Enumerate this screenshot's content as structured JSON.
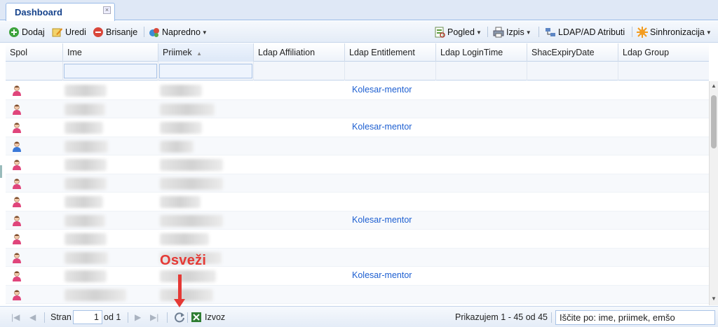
{
  "tab": {
    "title": "Dashboard",
    "close": "×"
  },
  "toolbar": {
    "add": "Dodaj",
    "edit": "Uredi",
    "delete": "Brisanje",
    "advanced": "Napredno",
    "view": "Pogled",
    "print": "Izpis",
    "ldap_attrs": "LDAP/AD Atributi",
    "sync": "Sinhronizacija"
  },
  "columns": {
    "gender": "Spol",
    "first_name": "Ime",
    "last_name": "Priimek",
    "sort_indicator": "▲",
    "affiliation": "Ldap Affiliation",
    "entitlement": "Ldap Entitlement",
    "login_time": "Ldap LoginTime",
    "expiry": "ShacExpiryDate",
    "group": "Ldap Group"
  },
  "rows": [
    {
      "gender": "female",
      "entitlement": "Kolesar-mentor"
    },
    {
      "gender": "female",
      "entitlement": ""
    },
    {
      "gender": "female",
      "entitlement": "Kolesar-mentor"
    },
    {
      "gender": "male",
      "entitlement": ""
    },
    {
      "gender": "female",
      "entitlement": ""
    },
    {
      "gender": "female",
      "entitlement": ""
    },
    {
      "gender": "female",
      "entitlement": ""
    },
    {
      "gender": "female",
      "entitlement": "Kolesar-mentor"
    },
    {
      "gender": "female",
      "entitlement": ""
    },
    {
      "gender": "female",
      "entitlement": ""
    },
    {
      "gender": "female",
      "entitlement": "Kolesar-mentor"
    },
    {
      "gender": "female",
      "entitlement": ""
    }
  ],
  "pager": {
    "page_label": "Stran",
    "page_value": "1",
    "of_label": "od 1",
    "export": "Izvoz",
    "display_info": "Prikazujem 1 - 45 od 45",
    "search_placeholder": "Iščite po: ime, priimek, emšo"
  },
  "annotation": {
    "label": "Osveži"
  },
  "colors": {
    "accent": "#15428b",
    "link": "#1d5fd1",
    "annotation": "#e53935",
    "female_icon": "#e0457b",
    "male_icon": "#3a78d8"
  }
}
